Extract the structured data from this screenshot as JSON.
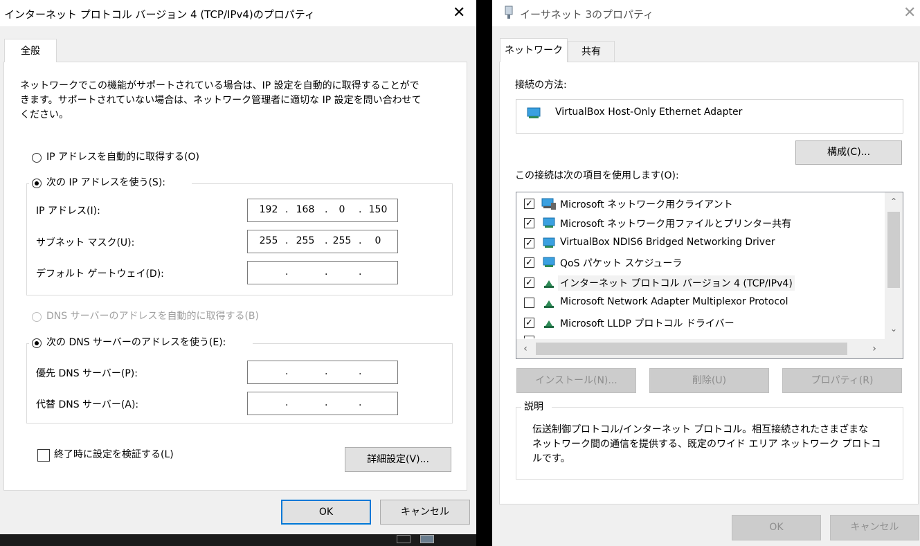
{
  "left_dialog": {
    "title": "インターネット プロトコル バージョン 4 (TCP/IPv4)のプロパティ",
    "tab_general": "全般",
    "description_line1": "ネットワークでこの機能がサポートされている場合は、IP 設定を自動的に取得することがで",
    "description_line2": "きます。サポートされていない場合は、ネットワーク管理者に適切な IP 設定を問い合わせて",
    "description_line3": "ください。",
    "radio_auto_ip": "IP アドレスを自動的に取得する(O)",
    "radio_manual_ip": "次の IP アドレスを使う(S):",
    "ip_address_label": "IP アドレス(I):",
    "subnet_mask_label": "サブネット マスク(U):",
    "default_gateway_label": "デフォルト ゲートウェイ(D):",
    "ip_address": [
      "192",
      "168",
      "0",
      "150"
    ],
    "subnet_mask": [
      "255",
      "255",
      "255",
      "0"
    ],
    "default_gateway": [
      "",
      "",
      "",
      ""
    ],
    "radio_auto_dns": "DNS サーバーのアドレスを自動的に取得する(B)",
    "radio_manual_dns": "次の DNS サーバーのアドレスを使う(E):",
    "preferred_dns_label": "優先 DNS サーバー(P):",
    "alternate_dns_label": "代替 DNS サーバー(A):",
    "preferred_dns": [
      "",
      "",
      "",
      ""
    ],
    "alternate_dns": [
      "",
      "",
      "",
      ""
    ],
    "validate_on_exit": "終了時に設定を検証する(L)",
    "advanced_button": "詳細設定(V)...",
    "ok_button": "OK",
    "cancel_button": "キャンセル"
  },
  "right_dialog": {
    "title": "イーサネット 3のプロパティ",
    "tab_network": "ネットワーク",
    "tab_sharing": "共有",
    "connect_using_label": "接続の方法:",
    "adapter_name": "VirtualBox Host-Only Ethernet Adapter",
    "configure_button": "構成(C)...",
    "items_label": "この接続は次の項目を使用します(O):",
    "items": [
      {
        "label": "Microsoft ネットワーク用クライアント",
        "checked": true,
        "icon": "network-client-icon"
      },
      {
        "label": "Microsoft ネットワーク用ファイルとプリンター共有",
        "checked": true,
        "icon": "network-service-icon"
      },
      {
        "label": "VirtualBox NDIS6 Bridged Networking Driver",
        "checked": true,
        "icon": "network-service-icon"
      },
      {
        "label": "QoS パケット スケジューラ",
        "checked": true,
        "icon": "network-service-icon"
      },
      {
        "label": "インターネット プロトコル バージョン 4 (TCP/IPv4)",
        "checked": true,
        "icon": "protocol-icon"
      },
      {
        "label": "Microsoft Network Adapter Multiplexor Protocol",
        "checked": false,
        "icon": "protocol-icon"
      },
      {
        "label": "Microsoft LLDP プロトコル ドライバー",
        "checked": true,
        "icon": "protocol-icon"
      }
    ],
    "install_button": "インストール(N)...",
    "uninstall_button": "削除(U)",
    "properties_button": "プロパティ(R)",
    "description_legend": "説明",
    "description_line1": "伝送制御プロトコル/インターネット プロトコル。相互接続されたさまざまな",
    "description_line2": "ネットワーク間の通信を提供する、既定のワイド エリア ネットワーク プロトコ",
    "description_line3": "ルです。",
    "ok_button": "OK",
    "cancel_button": "キャンセル"
  },
  "colors": {
    "accent": "#0078d7",
    "dialog_bg": "#f0f0f0",
    "disabled_text": "#a0a0a0"
  }
}
